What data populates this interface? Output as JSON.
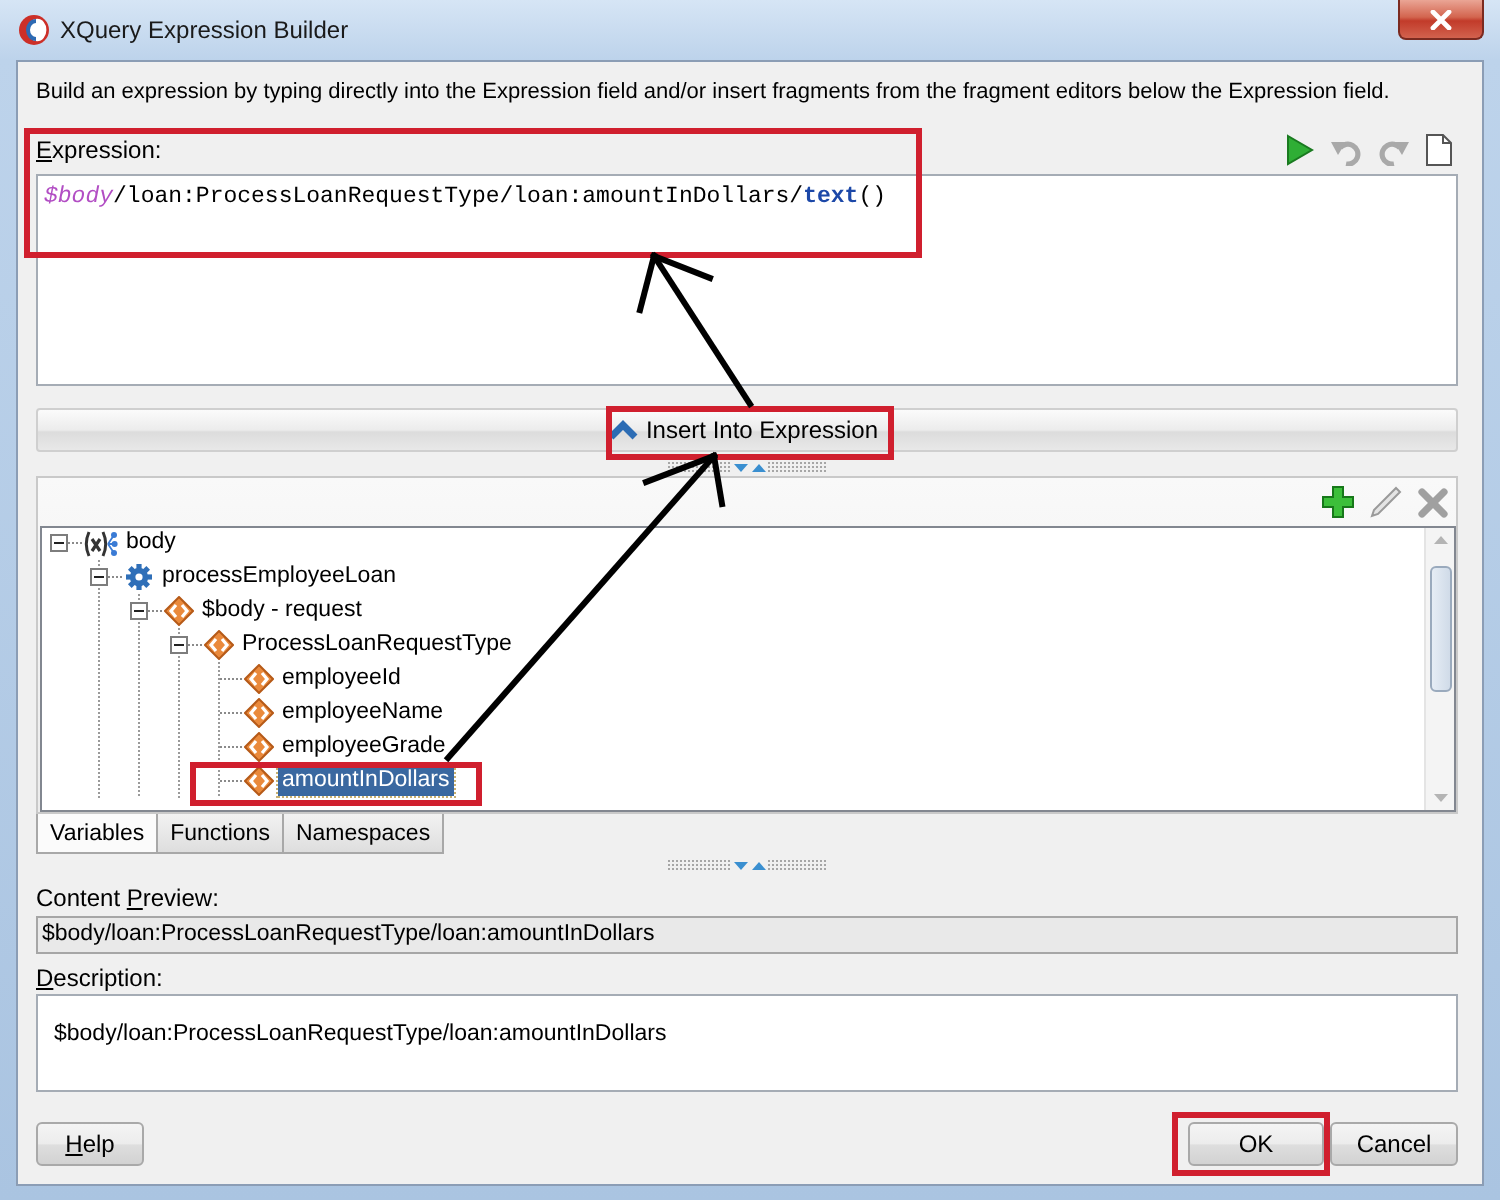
{
  "window": {
    "title": "XQuery Expression Builder"
  },
  "instructions": "Build an expression by typing directly into the Expression field and/or insert fragments from the fragment editors below the Expression field.",
  "expression": {
    "label": [
      {
        "text": "E",
        "underlined": true
      },
      {
        "text": "xpression:",
        "underlined": false
      }
    ],
    "tokens": [
      {
        "kind": "variable",
        "text": "$body"
      },
      {
        "kind": "path",
        "text": "/loan:ProcessLoanRequestType/loan:amountInDollars/"
      },
      {
        "kind": "function",
        "text": "text"
      },
      {
        "kind": "path",
        "text": "()"
      }
    ]
  },
  "insert_button": {
    "label": "Insert Into Expression"
  },
  "tree": [
    {
      "label": "body",
      "kind": "variable",
      "expanded": true,
      "selected": false,
      "children": [
        {
          "label": "processEmployeeLoan",
          "kind": "operation",
          "expanded": true,
          "selected": false,
          "children": [
            {
              "label": "$body - request",
              "kind": "element",
              "expanded": true,
              "selected": false,
              "children": [
                {
                  "label": "ProcessLoanRequestType",
                  "kind": "element",
                  "expanded": true,
                  "selected": false,
                  "children": [
                    {
                      "label": "employeeId",
                      "kind": "element",
                      "selected": false
                    },
                    {
                      "label": "employeeName",
                      "kind": "element",
                      "selected": false
                    },
                    {
                      "label": "employeeGrade",
                      "kind": "element",
                      "selected": false
                    },
                    {
                      "label": "amountInDollars",
                      "kind": "element",
                      "selected": true
                    }
                  ]
                }
              ]
            }
          ]
        }
      ]
    }
  ],
  "tabs": [
    {
      "label": "Variables",
      "selected": true
    },
    {
      "label": "Functions",
      "selected": false
    },
    {
      "label": "Namespaces",
      "selected": false
    }
  ],
  "content_preview": {
    "label": [
      {
        "text": "Content ",
        "underlined": false
      },
      {
        "text": "P",
        "underlined": true
      },
      {
        "text": "review:",
        "underlined": false
      }
    ],
    "value": "$body/loan:ProcessLoanRequestType/loan:amountInDollars"
  },
  "description": {
    "label": [
      {
        "text": "D",
        "underlined": true
      },
      {
        "text": "escription:",
        "underlined": false
      }
    ],
    "value": "$body/loan:ProcessLoanRequestType/loan:amountInDollars"
  },
  "buttons": [
    {
      "label": [
        {
          "text": "H",
          "underlined": true
        },
        {
          "text": "elp",
          "underlined": false
        }
      ],
      "kind": "help"
    },
    {
      "label": "OK",
      "kind": "ok"
    },
    {
      "label": "Cancel",
      "kind": "cancel"
    }
  ]
}
